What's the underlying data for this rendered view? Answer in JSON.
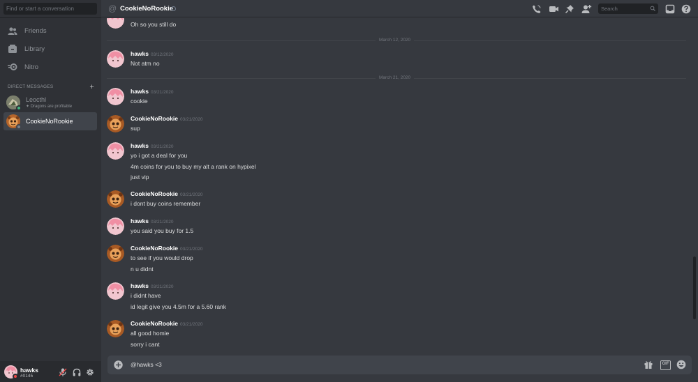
{
  "sidebar": {
    "search_placeholder": "Find or start a conversation",
    "nav": [
      {
        "label": "Friends",
        "icon": "friends-icon"
      },
      {
        "label": "Library",
        "icon": "library-icon"
      },
      {
        "label": "Nitro",
        "icon": "nitro-icon"
      }
    ],
    "dm_header": "DIRECT MESSAGES",
    "dms": [
      {
        "name": "Leocthl",
        "activity": "Dragons are profitable",
        "active": false
      },
      {
        "name": "CookieNoRookie",
        "active": true
      }
    ]
  },
  "user_panel": {
    "username": "hawks",
    "tag": "#0145"
  },
  "header": {
    "title": "CookieNoRookie",
    "search_placeholder": "Search"
  },
  "messages": {
    "top_partial": "Oh so you still do",
    "divider_1": "March 12, 2020",
    "divider_2": "March 21, 2020",
    "groups": [
      {
        "author": "hawks",
        "time": "03/12/2020",
        "lines": [
          "Not atm no"
        ]
      },
      {
        "author": "hawks",
        "time": "03/21/2020",
        "lines": [
          "cookie"
        ]
      },
      {
        "author": "CookieNoRookie",
        "time": "03/21/2020",
        "lines": [
          "sup"
        ]
      },
      {
        "author": "hawks",
        "time": "03/21/2020",
        "lines": [
          "yo i got a deal for you",
          "4m coins for you to buy my alt a rank on hypixel",
          "just vip"
        ]
      },
      {
        "author": "CookieNoRookie",
        "time": "03/21/2020",
        "lines": [
          "i dont buy coins remember"
        ]
      },
      {
        "author": "hawks",
        "time": "03/21/2020",
        "lines": [
          "you said you buy for 1.5"
        ]
      },
      {
        "author": "CookieNoRookie",
        "time": "03/21/2020",
        "lines": [
          "to see if you would drop",
          "n u didnt"
        ]
      },
      {
        "author": "hawks",
        "time": "03/21/2020",
        "lines": [
          "i didnt have",
          "id legit give you 4.5m for a 5.60 rank"
        ]
      },
      {
        "author": "CookieNoRookie",
        "time": "03/21/2020",
        "lines": [
          "all good homie",
          "sorry i cant"
        ]
      }
    ]
  },
  "composer": {
    "value": "@hawks <3",
    "gif_label": "GIF"
  },
  "colors": {
    "background": "#36393f",
    "sidebar": "#2f3136",
    "user_panel": "#292b2f",
    "input": "#40444b",
    "hawks_avatar": "#f4b6c2",
    "cookie_avatar": "#c97a3a"
  }
}
